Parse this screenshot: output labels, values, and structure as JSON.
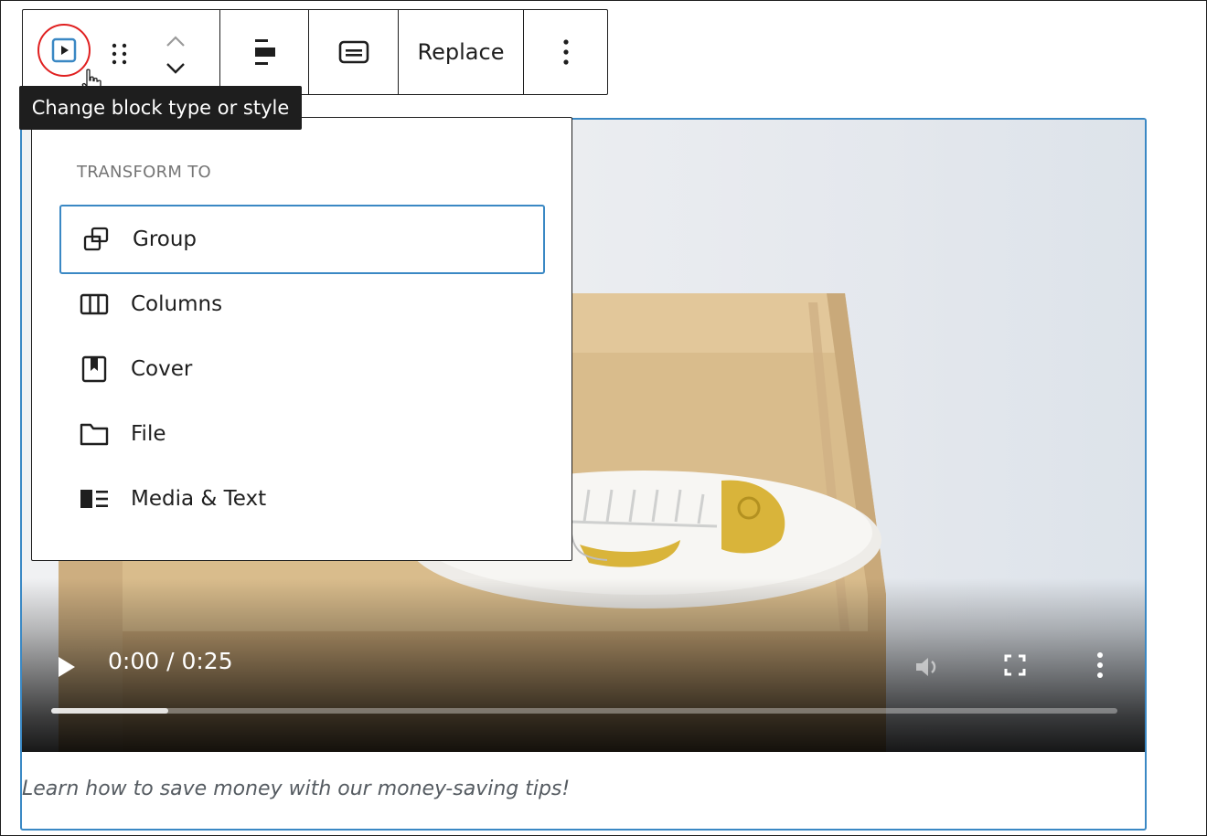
{
  "toolbar": {
    "replace_label": "Replace"
  },
  "tooltip": {
    "text": "Change block type or style"
  },
  "transform_menu": {
    "heading": "TRANSFORM TO",
    "items": [
      {
        "label": "Group",
        "icon": "group-icon",
        "active": true
      },
      {
        "label": "Columns",
        "icon": "columns-icon"
      },
      {
        "label": "Cover",
        "icon": "cover-icon"
      },
      {
        "label": "File",
        "icon": "file-icon"
      },
      {
        "label": "Media & Text",
        "icon": "media-text-icon"
      }
    ]
  },
  "video": {
    "time": "0:00 / 0:25",
    "progress": 0.11,
    "caption": "Learn how to save money with our money-saving tips!"
  },
  "colors": {
    "accent": "#3a88c4",
    "highlight_circle": "#e02020",
    "tooltip_bg": "#1e1e1e",
    "box": "#d6b98c",
    "gold": "#d9b43a"
  }
}
